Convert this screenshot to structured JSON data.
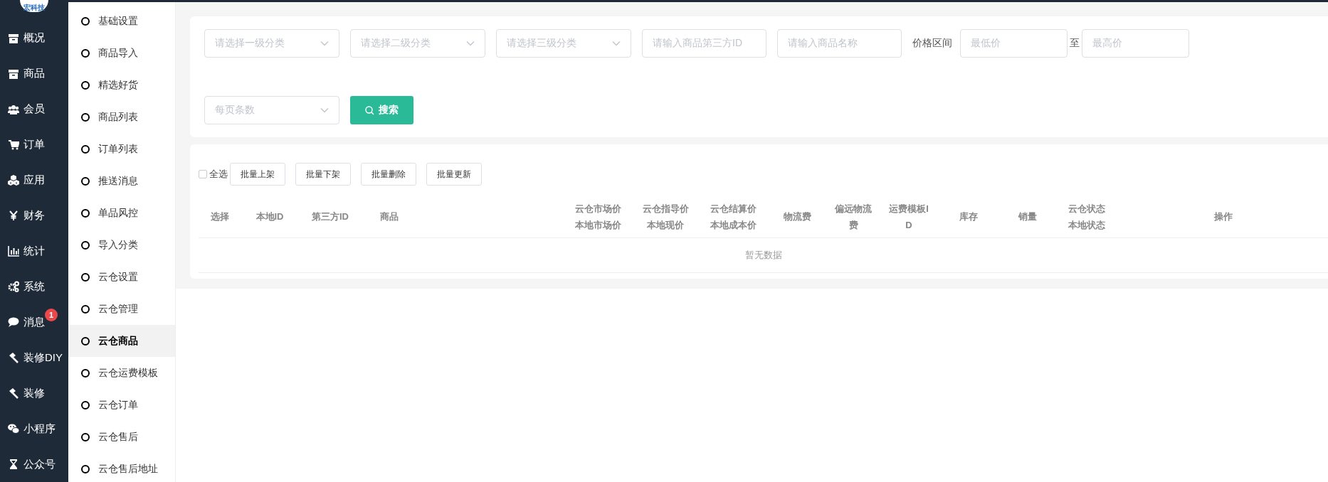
{
  "logo": {
    "text": "宏科技"
  },
  "main_menu": [
    {
      "label": "概况",
      "selected": false
    },
    {
      "label": "商品",
      "selected": false
    },
    {
      "label": "会员",
      "selected": false
    },
    {
      "label": "订单",
      "selected": false
    },
    {
      "label": "应用",
      "selected": false
    },
    {
      "label": "财务",
      "selected": false
    },
    {
      "label": "统计",
      "selected": false
    },
    {
      "label": "系统",
      "selected": false
    },
    {
      "label": "消息",
      "selected": false,
      "badge": "1"
    },
    {
      "label": "装修DIY",
      "selected": false
    },
    {
      "label": "装修",
      "selected": false
    },
    {
      "label": "小程序",
      "selected": false
    },
    {
      "label": "公众号",
      "selected": false
    }
  ],
  "sub_menu": [
    {
      "label": "基础设置",
      "selected": false
    },
    {
      "label": "商品导入",
      "selected": false
    },
    {
      "label": "精选好货",
      "selected": false
    },
    {
      "label": "商品列表",
      "selected": false
    },
    {
      "label": "订单列表",
      "selected": false
    },
    {
      "label": "推送消息",
      "selected": false
    },
    {
      "label": "单品风控",
      "selected": false
    },
    {
      "label": "导入分类",
      "selected": false
    },
    {
      "label": "云仓设置",
      "selected": false
    },
    {
      "label": "云仓管理",
      "selected": false
    },
    {
      "label": "云仓商品",
      "selected": true
    },
    {
      "label": "云仓运费模板",
      "selected": false
    },
    {
      "label": "云仓订单",
      "selected": false
    },
    {
      "label": "云仓售后",
      "selected": false
    },
    {
      "label": "云仓售后地址",
      "selected": false
    }
  ],
  "filters": [
    {
      "kind": "select",
      "placeholder": "请选择一级分类"
    },
    {
      "kind": "select",
      "placeholder": "请选择二级分类"
    },
    {
      "kind": "select",
      "placeholder": "请选择三级分类"
    },
    {
      "kind": "input",
      "placeholder": "请输入商品第三方ID"
    },
    {
      "kind": "input",
      "placeholder": "请输入商品名称"
    },
    {
      "kind": "label",
      "text": "价格区间"
    },
    {
      "kind": "price",
      "placeholder": "最低价"
    },
    {
      "kind": "sep",
      "text": "至"
    },
    {
      "kind": "price",
      "placeholder": "最高价"
    },
    {
      "kind": "break"
    },
    {
      "kind": "select",
      "placeholder": "每页条数"
    },
    {
      "kind": "button",
      "text": "搜索"
    }
  ],
  "bulk": {
    "select_all": {
      "label": "全选",
      "checked": false
    },
    "buttons": [
      "批量上架",
      "批量下架",
      "批量删除",
      "批量更新"
    ]
  },
  "table": {
    "columns": [
      [
        "选择"
      ],
      [
        "本地ID"
      ],
      [
        "第三方ID"
      ],
      [
        "商品"
      ],
      [
        "云仓市场价",
        "本地市场价"
      ],
      [
        "云仓指导价",
        "本地现价"
      ],
      [
        "云仓结算价",
        "本地成本价"
      ],
      [
        "物流费"
      ],
      [
        "偏远物流",
        "费"
      ],
      [
        "运费模板I",
        "D"
      ],
      [
        "库存"
      ],
      [
        "销量"
      ],
      [
        "云仓状态",
        "本地状态"
      ],
      [
        "操作"
      ]
    ],
    "empty": "暂无数据"
  }
}
